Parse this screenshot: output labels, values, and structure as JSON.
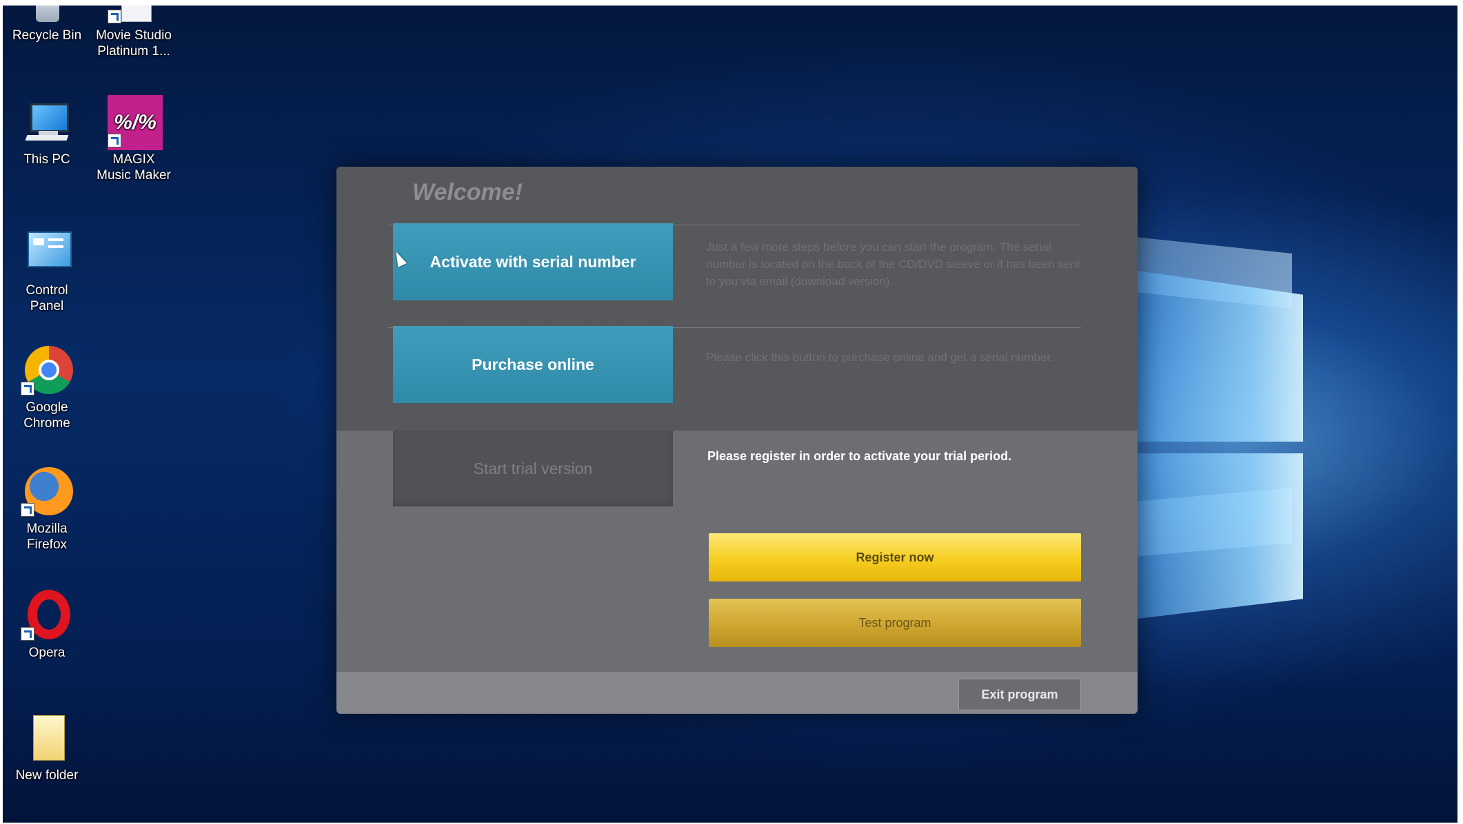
{
  "desktop": {
    "icons": [
      {
        "label": "Recycle Bin",
        "icon": "recycle-bin-icon"
      },
      {
        "label": "Movie Studio\nPlatinum 1...",
        "icon": "movie-studio-icon"
      },
      {
        "label": "This PC",
        "icon": "this-pc-icon"
      },
      {
        "label": "MAGIX\nMusic Maker",
        "icon": "magix-music-maker-icon",
        "glyph_text": "%/%"
      },
      {
        "label": "Control\nPanel",
        "icon": "control-panel-icon"
      },
      {
        "label": "Google\nChrome",
        "icon": "chrome-icon"
      },
      {
        "label": "Mozilla\nFirefox",
        "icon": "firefox-icon"
      },
      {
        "label": "Opera",
        "icon": "opera-icon"
      },
      {
        "label": "New folder",
        "icon": "folder-icon"
      }
    ]
  },
  "dialog": {
    "title": "Welcome!",
    "options": [
      {
        "button": "Activate with serial number",
        "description": "Just a few more steps before you can start the program. The serial number is located on the back of the CD/DVD sleeve or if has been sent to you via email (download version)."
      },
      {
        "button": "Purchase online",
        "description": "Please click this button to purchase online and get a serial number."
      },
      {
        "button": "Start trial version",
        "description": "Please register in order to activate your trial period."
      }
    ],
    "register_button": "Register now",
    "test_button": "Test program",
    "exit_button": "Exit program"
  },
  "colors": {
    "accent_teal": "#3a97b6",
    "accent_yellow": "#f6cd1e",
    "dialog_bg": "#5a5c60"
  }
}
